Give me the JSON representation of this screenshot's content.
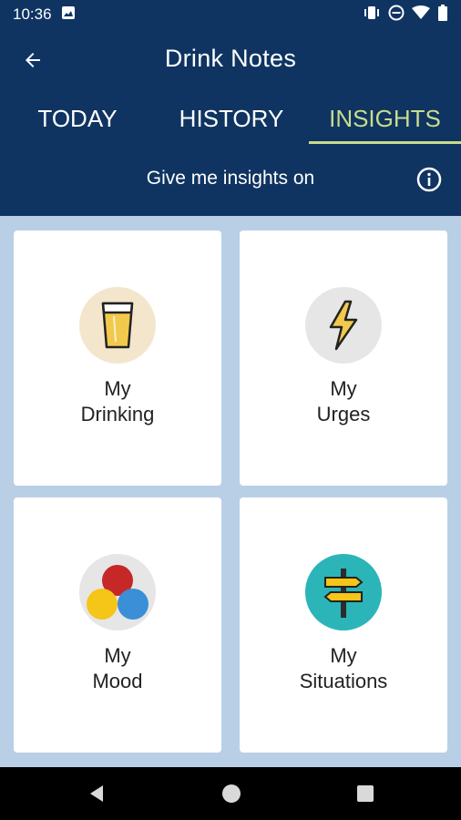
{
  "status_bar": {
    "time": "10:36",
    "icons": [
      "image-icon",
      "vibrate-icon",
      "do-not-disturb-icon",
      "wifi-icon",
      "battery-icon"
    ]
  },
  "header": {
    "title": "Drink Notes",
    "back_icon": "back-arrow-icon",
    "tabs": [
      {
        "label": "TODAY",
        "active": false
      },
      {
        "label": "HISTORY",
        "active": false
      },
      {
        "label": "INSIGHTS",
        "active": true
      }
    ],
    "subheader": "Give me insights on",
    "info_icon": "info-icon"
  },
  "cards": [
    {
      "line1": "My",
      "line2": "Drinking",
      "icon": "beer-glass-icon"
    },
    {
      "line1": "My",
      "line2": "Urges",
      "icon": "lightning-icon"
    },
    {
      "line1": "My",
      "line2": "Mood",
      "icon": "mood-circles-icon"
    },
    {
      "line1": "My",
      "line2": "Situations",
      "icon": "signpost-icon"
    }
  ],
  "colors": {
    "header_bg": "#0f3461",
    "content_bg": "#b9cfe6",
    "active_tab": "#c8dc8c"
  }
}
